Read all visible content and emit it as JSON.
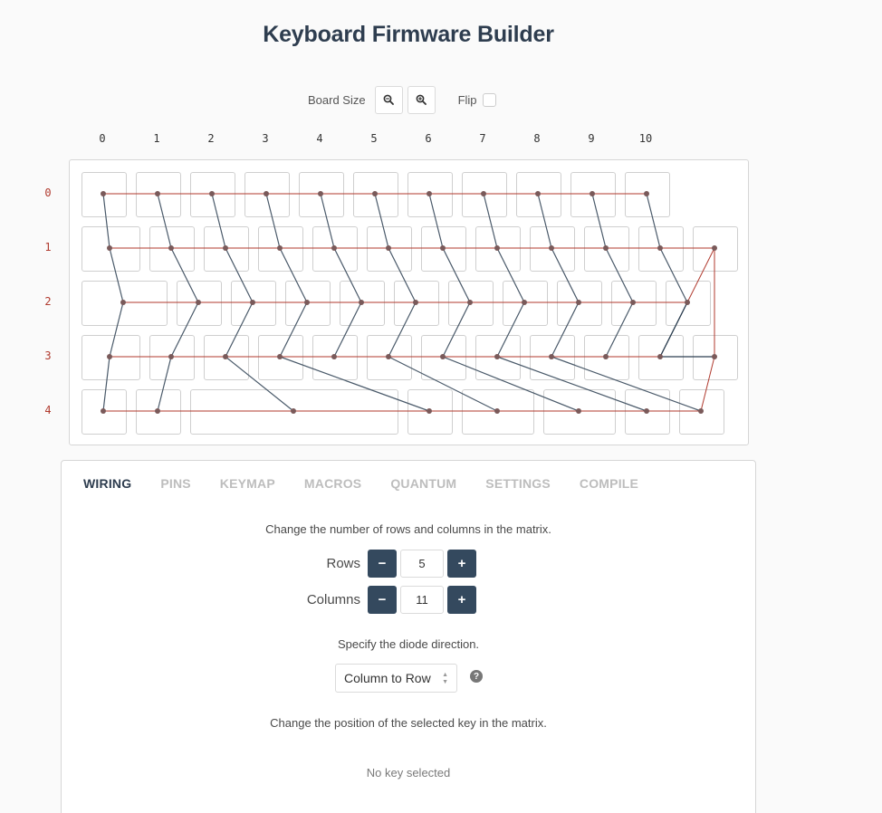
{
  "page": {
    "title": "Keyboard Firmware Builder"
  },
  "toolbar": {
    "board_size_label": "Board Size",
    "zoom_out_icon": "zoom-out-icon",
    "zoom_in_icon": "zoom-in-icon",
    "flip_label": "Flip",
    "flip_checked": false
  },
  "matrix": {
    "columns": [
      "0",
      "1",
      "2",
      "3",
      "4",
      "5",
      "6",
      "7",
      "8",
      "9",
      "10"
    ],
    "rows": [
      "0",
      "1",
      "2",
      "3",
      "4"
    ],
    "row_wire_color": "#b03a2e",
    "col_wire_color": "#4a5a6a"
  },
  "tabs": [
    "WIRING",
    "PINS",
    "KEYMAP",
    "MACROS",
    "QUANTUM",
    "SETTINGS",
    "COMPILE"
  ],
  "active_tab": "WIRING",
  "wiring": {
    "matrix_description": "Change the number of rows and columns in the matrix.",
    "rows_label": "Rows",
    "rows_value": "5",
    "columns_label": "Columns",
    "columns_value": "11",
    "decrement_symbol": "−",
    "increment_symbol": "+",
    "diode_description": "Specify the diode direction.",
    "diode_direction": "Column to Row",
    "diode_options": [
      "Column to Row"
    ],
    "help_symbol": "?",
    "position_description": "Change the position of the selected key in the matrix.",
    "no_key_selected": "No key selected"
  }
}
